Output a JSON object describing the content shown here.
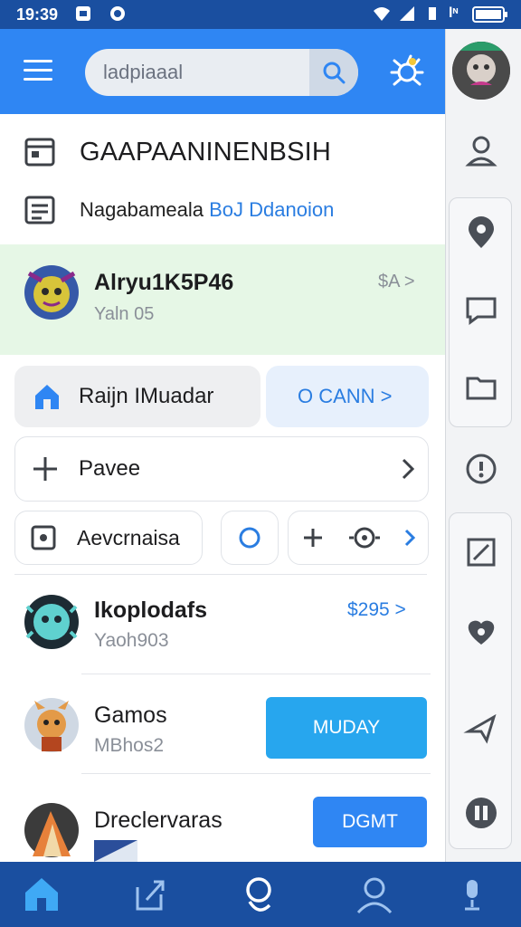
{
  "status": {
    "time": "19:39",
    "network": "lᶰ"
  },
  "appbar": {
    "search_placeholder": "ladpiaaal"
  },
  "header": {
    "title": "GAAPAANINENBSIH",
    "subtitle_plain": "Nagabameala ",
    "subtitle_link": "BoJ Ddanoion"
  },
  "featured": {
    "name": "Alryu1K5P46",
    "sub": "Yaln 05",
    "price": "$A >"
  },
  "actions": {
    "primary_label": "Raijn IMuadar",
    "secondary_label": "O CANN >",
    "add_label": "Pavee",
    "media_label": "Aevcrnaisa"
  },
  "list": [
    {
      "name": "Ikoplodafs",
      "sub": "Yaoh903",
      "price": "$295 >"
    },
    {
      "name": "Gamos",
      "sub": "MBhos2",
      "button": "MUDAY"
    },
    {
      "name": "Dreclervaras",
      "sub": "",
      "button": "DGMT"
    }
  ],
  "colors": {
    "brand": "#2f86f3",
    "statusbar": "#1a4fa0",
    "highlight": "#e6f7e6",
    "accent": "#27a6ee"
  }
}
